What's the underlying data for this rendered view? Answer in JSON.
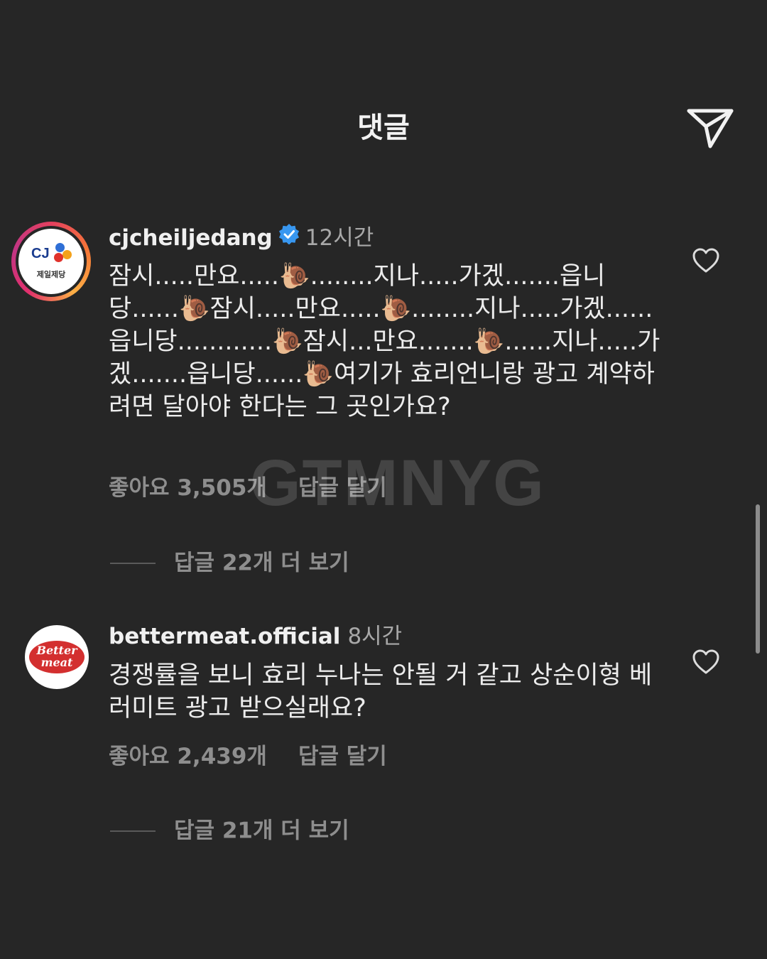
{
  "header": {
    "title": "댓글",
    "send_icon": "paper-plane-icon"
  },
  "comments": [
    {
      "username": "cjcheiljedang",
      "verified": true,
      "time": "12시간",
      "avatar": {
        "logo_text": "CJ",
        "logo_sub": "제일제당"
      },
      "text": "잠시.....만요.....🐌........지나.....가겠.......읍니당......🐌잠시.....만요.....🐌........지나.....가겠......읍니당............🐌잠시...만요.......🐌......지나.....가겠.......읍니당......🐌여기가 효리언니랑 광고 계약하려면 달아야 한다는 그 곳인가요?",
      "likes": "좋아요 3,505개",
      "reply_label": "답글 달기",
      "view_replies": "답글 22개 더 보기"
    },
    {
      "username": "bettermeat.official",
      "verified": false,
      "time": "8시간",
      "avatar": {
        "logo_text": "Better meat"
      },
      "text": "경쟁률을 보니 효리 누나는 안될 거 같고 상순이형 베러미트 광고 받으실래요?",
      "likes": "좋아요 2,439개",
      "reply_label": "답글 달기",
      "view_replies": "답글 21개 더 보기"
    }
  ],
  "watermark": "GTMNYG",
  "colors": {
    "background": "#262626",
    "verified_badge": "#3897f0",
    "secondary_text": "#8e8e8e",
    "brand_red": "#d32f2f"
  }
}
